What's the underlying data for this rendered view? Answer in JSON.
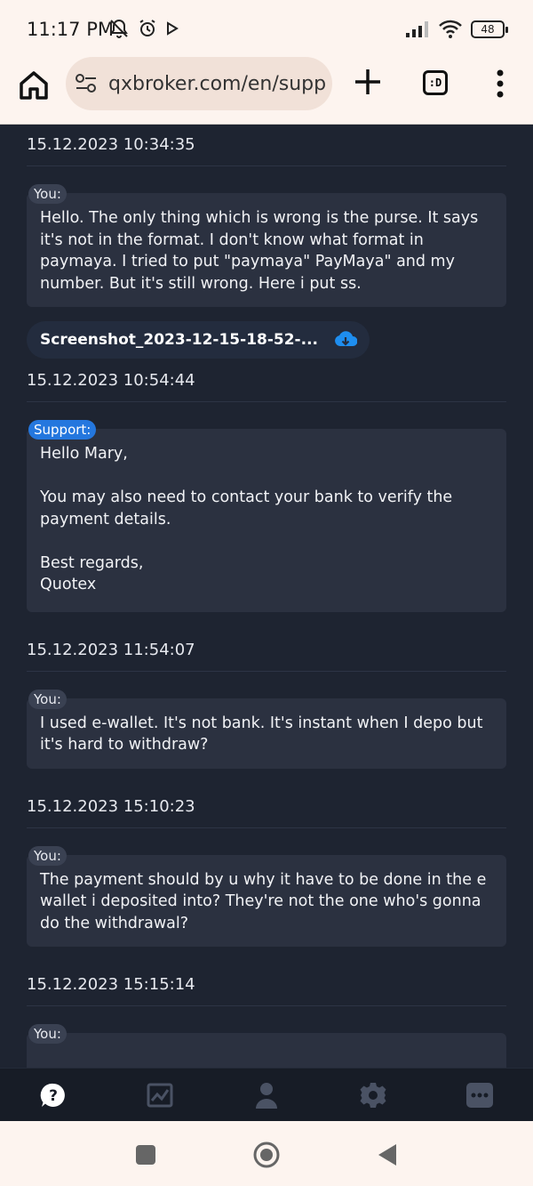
{
  "status_bar": {
    "time": "11:17 PM",
    "battery": "48"
  },
  "browser": {
    "url": "qxbroker.com/en/supp",
    "tabs_label": ":D"
  },
  "messages": [
    {
      "timestamp": "15.12.2023 10:34:35",
      "sender": "You:",
      "sender_type": "user",
      "text": "Hello. The only thing which is wrong is the purse. It says it's not in the format. I don't know what format in paymaya. I tried to put \"paymaya\" PayMaya\" and my number. But it's still wrong. Here i put ss.",
      "attachment": "Screenshot_2023-12-15-18-52-..."
    },
    {
      "timestamp": "15.12.2023 10:54:44",
      "sender": "Support:",
      "sender_type": "support",
      "text": "Hello Mary,\n\nYou may also need to contact your bank to verify the payment details.\n\nBest regards,\nQuotex"
    },
    {
      "timestamp": "15.12.2023 11:54:07",
      "sender": "You:",
      "sender_type": "user",
      "text": "I used e-wallet. It's not bank. It's instant when I depo but it's hard to withdraw?"
    },
    {
      "timestamp": "15.12.2023 15:10:23",
      "sender": "You:",
      "sender_type": "user",
      "text": "The payment should by u why it have to be done in the e wallet i deposited into? They're not the one who's gonna do the withdrawal?"
    },
    {
      "timestamp": "15.12.2023 15:15:14",
      "sender": "You:",
      "sender_type": "user",
      "text": ""
    }
  ],
  "bottom_nav": [
    {
      "icon": "help-icon",
      "active": true
    },
    {
      "icon": "chart-icon",
      "active": false
    },
    {
      "icon": "user-icon",
      "active": false
    },
    {
      "icon": "gear-icon",
      "active": false
    },
    {
      "icon": "more-icon",
      "active": false
    }
  ],
  "colors": {
    "background": "#1e2431",
    "bubble": "#2b3140",
    "support_tag": "#2477de",
    "download_icon": "#1e8ef0"
  }
}
